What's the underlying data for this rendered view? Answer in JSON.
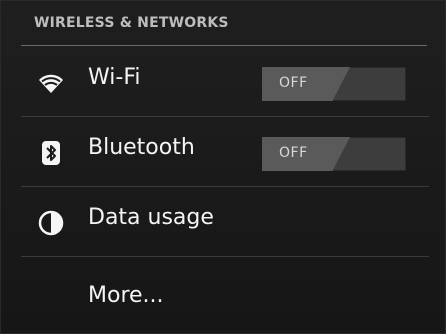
{
  "section": {
    "title": "WIRELESS & NETWORKS"
  },
  "items": [
    {
      "label": "Wi-Fi",
      "icon": "wifi-icon",
      "toggle_text": "OFF",
      "toggle_state": "off"
    },
    {
      "label": "Bluetooth",
      "icon": "bluetooth-icon",
      "toggle_text": "OFF",
      "toggle_state": "off"
    },
    {
      "label": "Data usage",
      "icon": "data-usage-icon"
    },
    {
      "label": "More..."
    }
  ],
  "colors": {
    "background": "#1c1c1c",
    "text": "#f4f4f4",
    "header_text": "#bdbdbd",
    "toggle_off_segment": "#5a5a5a",
    "toggle_track": "#3d3d3d"
  }
}
